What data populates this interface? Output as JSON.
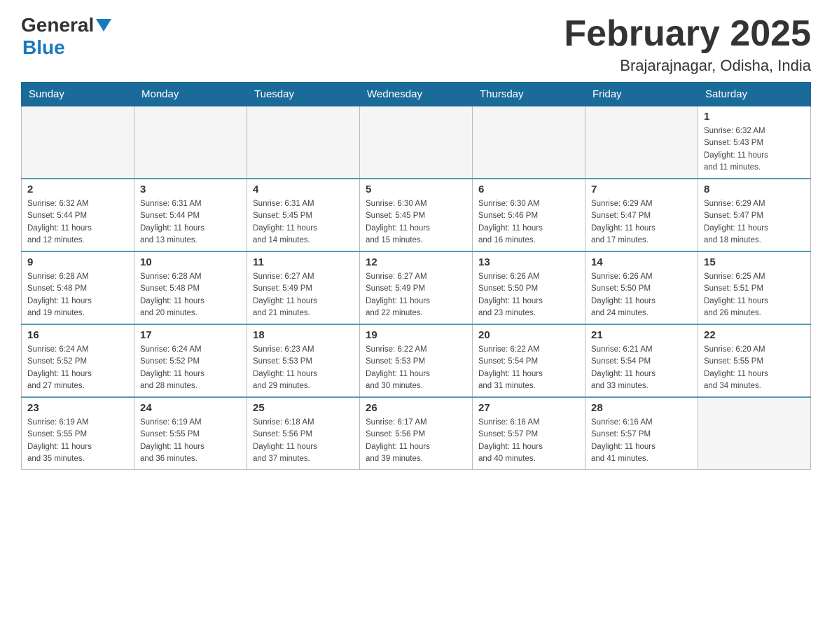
{
  "header": {
    "logo_general": "General",
    "logo_blue": "Blue",
    "title": "February 2025",
    "subtitle": "Brajarajnagar, Odisha, India"
  },
  "weekdays": [
    "Sunday",
    "Monday",
    "Tuesday",
    "Wednesday",
    "Thursday",
    "Friday",
    "Saturday"
  ],
  "weeks": [
    [
      {
        "day": "",
        "info": ""
      },
      {
        "day": "",
        "info": ""
      },
      {
        "day": "",
        "info": ""
      },
      {
        "day": "",
        "info": ""
      },
      {
        "day": "",
        "info": ""
      },
      {
        "day": "",
        "info": ""
      },
      {
        "day": "1",
        "info": "Sunrise: 6:32 AM\nSunset: 5:43 PM\nDaylight: 11 hours\nand 11 minutes."
      }
    ],
    [
      {
        "day": "2",
        "info": "Sunrise: 6:32 AM\nSunset: 5:44 PM\nDaylight: 11 hours\nand 12 minutes."
      },
      {
        "day": "3",
        "info": "Sunrise: 6:31 AM\nSunset: 5:44 PM\nDaylight: 11 hours\nand 13 minutes."
      },
      {
        "day": "4",
        "info": "Sunrise: 6:31 AM\nSunset: 5:45 PM\nDaylight: 11 hours\nand 14 minutes."
      },
      {
        "day": "5",
        "info": "Sunrise: 6:30 AM\nSunset: 5:45 PM\nDaylight: 11 hours\nand 15 minutes."
      },
      {
        "day": "6",
        "info": "Sunrise: 6:30 AM\nSunset: 5:46 PM\nDaylight: 11 hours\nand 16 minutes."
      },
      {
        "day": "7",
        "info": "Sunrise: 6:29 AM\nSunset: 5:47 PM\nDaylight: 11 hours\nand 17 minutes."
      },
      {
        "day": "8",
        "info": "Sunrise: 6:29 AM\nSunset: 5:47 PM\nDaylight: 11 hours\nand 18 minutes."
      }
    ],
    [
      {
        "day": "9",
        "info": "Sunrise: 6:28 AM\nSunset: 5:48 PM\nDaylight: 11 hours\nand 19 minutes."
      },
      {
        "day": "10",
        "info": "Sunrise: 6:28 AM\nSunset: 5:48 PM\nDaylight: 11 hours\nand 20 minutes."
      },
      {
        "day": "11",
        "info": "Sunrise: 6:27 AM\nSunset: 5:49 PM\nDaylight: 11 hours\nand 21 minutes."
      },
      {
        "day": "12",
        "info": "Sunrise: 6:27 AM\nSunset: 5:49 PM\nDaylight: 11 hours\nand 22 minutes."
      },
      {
        "day": "13",
        "info": "Sunrise: 6:26 AM\nSunset: 5:50 PM\nDaylight: 11 hours\nand 23 minutes."
      },
      {
        "day": "14",
        "info": "Sunrise: 6:26 AM\nSunset: 5:50 PM\nDaylight: 11 hours\nand 24 minutes."
      },
      {
        "day": "15",
        "info": "Sunrise: 6:25 AM\nSunset: 5:51 PM\nDaylight: 11 hours\nand 26 minutes."
      }
    ],
    [
      {
        "day": "16",
        "info": "Sunrise: 6:24 AM\nSunset: 5:52 PM\nDaylight: 11 hours\nand 27 minutes."
      },
      {
        "day": "17",
        "info": "Sunrise: 6:24 AM\nSunset: 5:52 PM\nDaylight: 11 hours\nand 28 minutes."
      },
      {
        "day": "18",
        "info": "Sunrise: 6:23 AM\nSunset: 5:53 PM\nDaylight: 11 hours\nand 29 minutes."
      },
      {
        "day": "19",
        "info": "Sunrise: 6:22 AM\nSunset: 5:53 PM\nDaylight: 11 hours\nand 30 minutes."
      },
      {
        "day": "20",
        "info": "Sunrise: 6:22 AM\nSunset: 5:54 PM\nDaylight: 11 hours\nand 31 minutes."
      },
      {
        "day": "21",
        "info": "Sunrise: 6:21 AM\nSunset: 5:54 PM\nDaylight: 11 hours\nand 33 minutes."
      },
      {
        "day": "22",
        "info": "Sunrise: 6:20 AM\nSunset: 5:55 PM\nDaylight: 11 hours\nand 34 minutes."
      }
    ],
    [
      {
        "day": "23",
        "info": "Sunrise: 6:19 AM\nSunset: 5:55 PM\nDaylight: 11 hours\nand 35 minutes."
      },
      {
        "day": "24",
        "info": "Sunrise: 6:19 AM\nSunset: 5:55 PM\nDaylight: 11 hours\nand 36 minutes."
      },
      {
        "day": "25",
        "info": "Sunrise: 6:18 AM\nSunset: 5:56 PM\nDaylight: 11 hours\nand 37 minutes."
      },
      {
        "day": "26",
        "info": "Sunrise: 6:17 AM\nSunset: 5:56 PM\nDaylight: 11 hours\nand 39 minutes."
      },
      {
        "day": "27",
        "info": "Sunrise: 6:16 AM\nSunset: 5:57 PM\nDaylight: 11 hours\nand 40 minutes."
      },
      {
        "day": "28",
        "info": "Sunrise: 6:16 AM\nSunset: 5:57 PM\nDaylight: 11 hours\nand 41 minutes."
      },
      {
        "day": "",
        "info": ""
      }
    ]
  ]
}
